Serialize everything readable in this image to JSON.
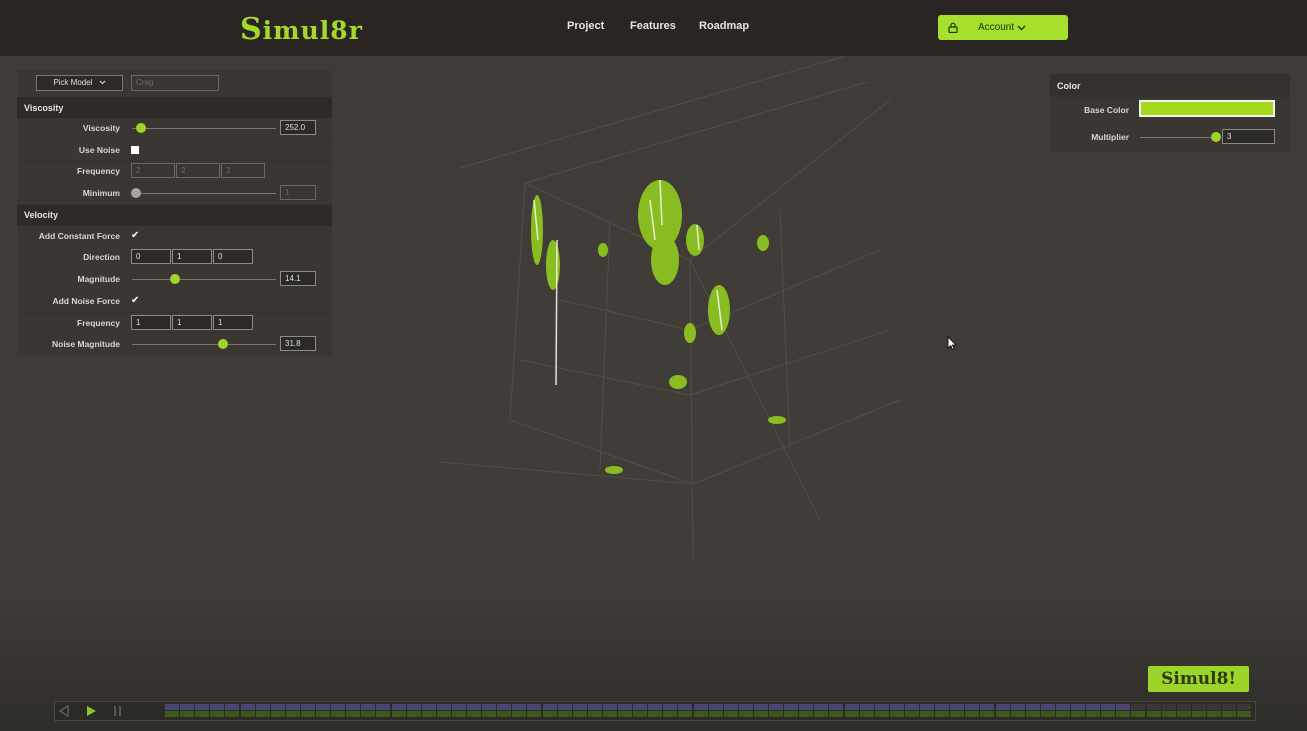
{
  "app": {
    "logo_first": "S",
    "logo_rest": "imul8r",
    "badge": "Simul8!"
  },
  "nav": {
    "project": "Project",
    "features": "Features",
    "roadmap": "Roadmap",
    "account": "Account"
  },
  "icons": {
    "lock": "lock-icon",
    "chevron": "chevron-down-icon",
    "cursor": "mouse-cursor-icon",
    "prev": "previous-icon",
    "play": "play-icon",
    "pause": "pause-icon"
  },
  "colors": {
    "accent": "#a4e02c",
    "panel": "#3a3733",
    "header": "#2a2522",
    "base_color": "#a4d81c"
  },
  "left": {
    "pick_model": "Pick Model",
    "model_placeholder": "Crag",
    "viscosity_section": "Viscosity",
    "velocity_section": "Velocity",
    "viscosity": {
      "label": "Viscosity",
      "value": "252.0",
      "slider": 0.06
    },
    "use_noise": {
      "label": "Use Noise",
      "checked": false
    },
    "frequency1": {
      "label": "Frequency",
      "x": "2",
      "y": "2",
      "z": "2"
    },
    "minimum": {
      "label": "Minimum",
      "value": "1",
      "slider": 0.03
    },
    "add_constant_force": {
      "label": "Add Constant Force",
      "checked": true
    },
    "direction": {
      "label": "Direction",
      "x": "0",
      "y": "1",
      "z": "0"
    },
    "magnitude": {
      "label": "Magnitude",
      "value": "14.1",
      "slider": 0.3
    },
    "add_noise_force": {
      "label": "Add Noise Force",
      "checked": true
    },
    "frequency2": {
      "label": "Frequency",
      "x": "1",
      "y": "1",
      "z": "1"
    },
    "noise_magnitude": {
      "label": "Noise Magnitude",
      "value": "31.8",
      "slider": 0.63
    }
  },
  "right": {
    "title": "Color",
    "base_color_label": "Base Color",
    "multiplier": {
      "label": "Multiplier",
      "value": "3",
      "slider": 0.97
    }
  },
  "checkmark": "✔"
}
